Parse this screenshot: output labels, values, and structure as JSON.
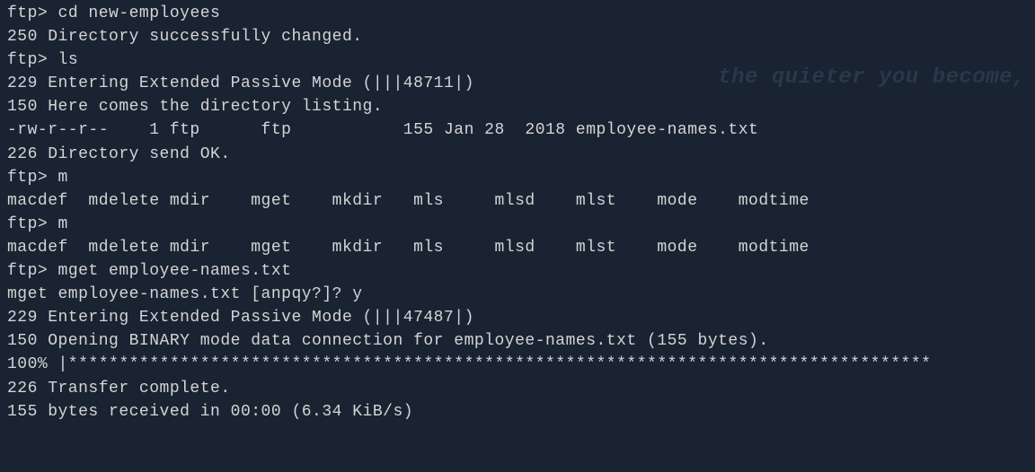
{
  "watermark": "the quieter you become,",
  "prompt": "ftp> ",
  "lines": {
    "l1_prompt": "ftp> ",
    "l1_cmd": "cd new-employees",
    "l2": "250 Directory successfully changed.",
    "l3_prompt": "ftp> ",
    "l3_cmd": "ls",
    "l4": "229 Entering Extended Passive Mode (|||48711|)",
    "l5": "150 Here comes the directory listing.",
    "l6": "-rw-r--r--    1 ftp      ftp           155 Jan 28  2018 employee-names.txt",
    "l7": "226 Directory send OK.",
    "l8_prompt": "ftp> ",
    "l8_cmd": "m",
    "l9": "macdef  mdelete mdir    mget    mkdir   mls     mlsd    mlst    mode    modtime",
    "l10_prompt": "ftp> ",
    "l10_cmd": "m",
    "l11": "macdef  mdelete mdir    mget    mkdir   mls     mlsd    mlst    mode    modtime",
    "l12_prompt": "ftp> ",
    "l12_cmd": "mget employee-names.txt",
    "l13": "mget employee-names.txt [anpqy?]? y",
    "l14": "229 Entering Extended Passive Mode (|||47487|)",
    "l15": "150 Opening BINARY mode data connection for employee-names.txt (155 bytes).",
    "l16": "100% |*************************************************************************************",
    "l17": "226 Transfer complete.",
    "l18": "155 bytes received in 00:00 (6.34 KiB/s)"
  }
}
